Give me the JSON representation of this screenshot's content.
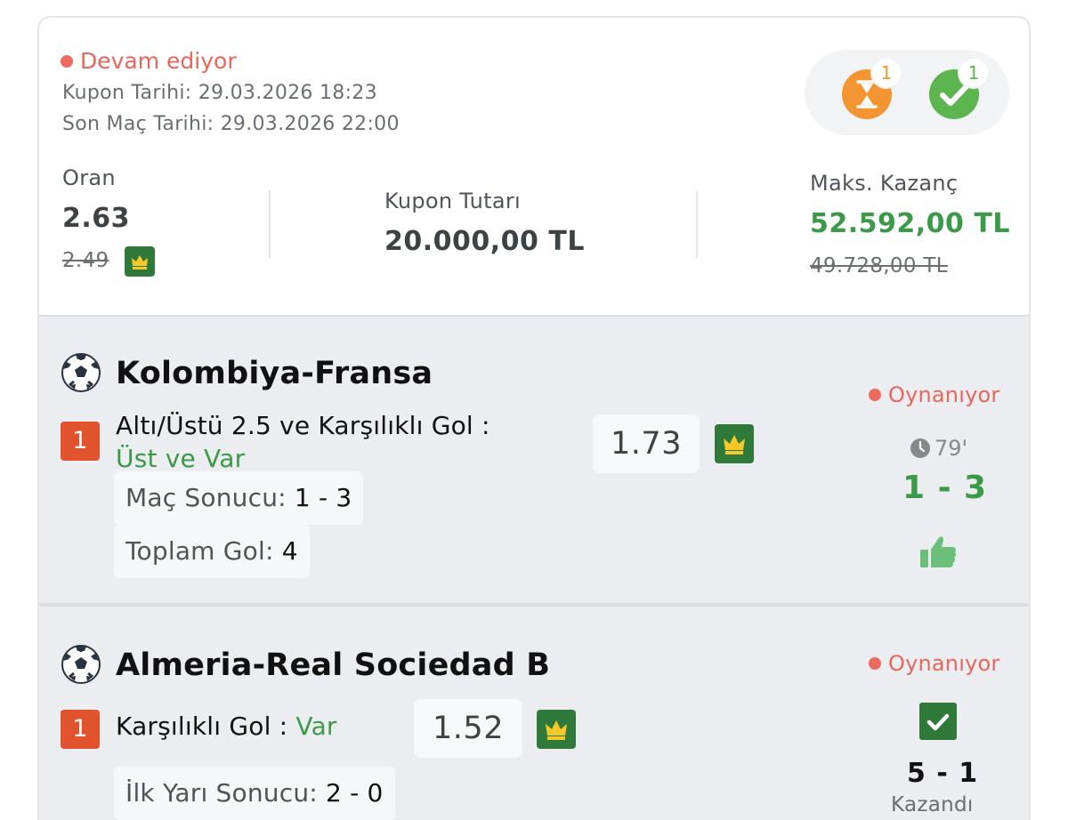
{
  "coupon": {
    "status": "Devam ediyor",
    "coupon_date_label": "Kupon Tarihi:",
    "coupon_date": "29.03.2026 18:23",
    "last_match_label": "Son Maç Tarihi:",
    "last_match_date": "29.03.2026 22:00",
    "pending_count": "1",
    "won_count": "1",
    "odds_label": "Oran",
    "odds_value": "2.63",
    "odds_old": "2.49",
    "amount_label": "Kupon Tutarı",
    "amount_value": "20.000,00 TL",
    "max_win_label": "Maks. Kazanç",
    "max_win_value": "52.592,00 TL",
    "max_win_old": "49.728,00 TL"
  },
  "matches": [
    {
      "title": "Kolombiya-Fransa",
      "market_number": "1",
      "market_name": "Altı/Üstü 2.5 ve Karşılıklı Gol :",
      "market_selection": "Üst ve Var",
      "odd": "1.73",
      "chips": [
        {
          "label": "Maç Sonucu:",
          "value": "1 - 3"
        },
        {
          "label": "Toplam Gol:",
          "value": "4"
        }
      ],
      "status": "Oynanıyor",
      "minute": "79'",
      "score": "1 - 3",
      "result_icon": "thumbs-up-icon"
    },
    {
      "title": "Almeria-Real Sociedad B",
      "market_number": "1",
      "market_name": "Karşılıklı Gol :",
      "market_selection": "Var",
      "odd": "1.52",
      "chips": [
        {
          "label": "İlk Yarı Sonucu:",
          "value": "2 - 0"
        }
      ],
      "status": "Oynanıyor",
      "score": "5 - 1",
      "result": "Kazandı",
      "result_icon": "check-icon"
    }
  ],
  "colors": {
    "live_red": "#ec6a5e",
    "win_green": "#3a9a48",
    "badge_orange": "#e0532c",
    "crown_bg": "#2f7a3a"
  }
}
